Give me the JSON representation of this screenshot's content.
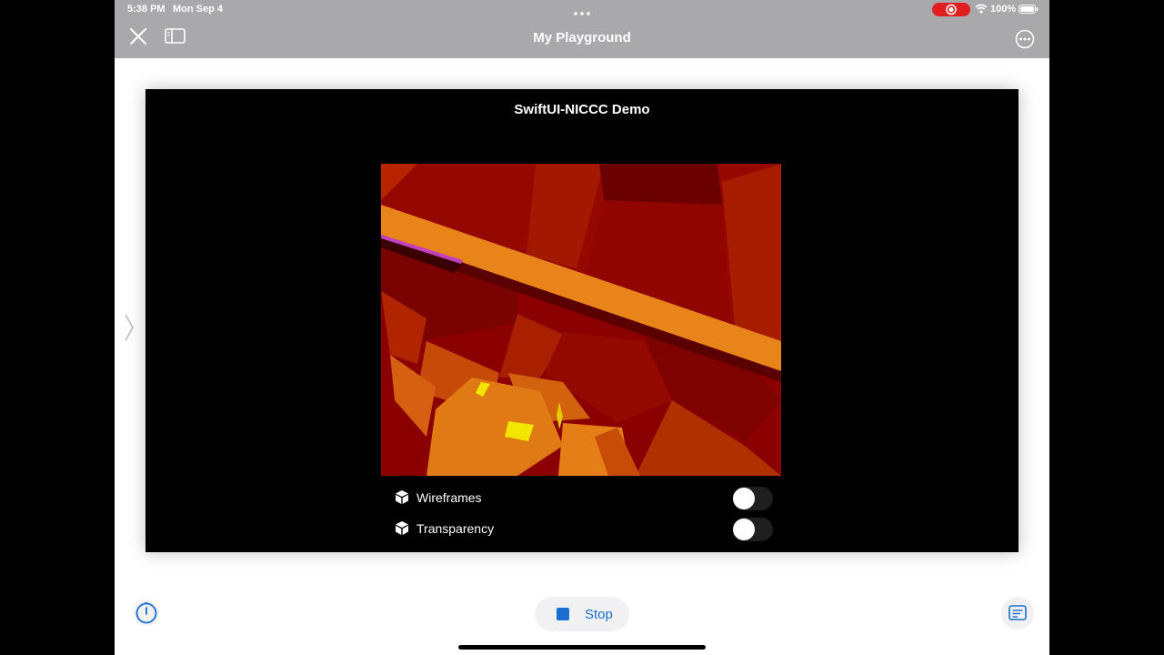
{
  "status_bar": {
    "time": "5:38 PM",
    "date": "Mon Sep 4",
    "battery": "100%",
    "icons": [
      "screen-recording-icon",
      "wifi-icon",
      "battery-icon"
    ]
  },
  "nav": {
    "title": "My Playground",
    "icons": [
      "close-icon",
      "sidebar-icon",
      "more-icon",
      "sidebar-handle-icon"
    ]
  },
  "live_view": {
    "title": "SwiftUI-NICCC Demo",
    "toggles": [
      {
        "label": "Wireframes",
        "on": false,
        "icon": "cube-icon"
      },
      {
        "label": "Transparency",
        "on": false,
        "icon": "cube-icon"
      }
    ]
  },
  "toolbar": {
    "stop_label": "Stop",
    "icons": [
      "timer-icon",
      "stop-icon",
      "console-icon"
    ]
  },
  "colors": {
    "chrome": "#a9a9ab",
    "accent": "#1a6fd0",
    "record": "#e02020",
    "scene_dark_red": "#8b0000",
    "scene_orange": "#e08418",
    "scene_yellow": "#f2e600"
  }
}
